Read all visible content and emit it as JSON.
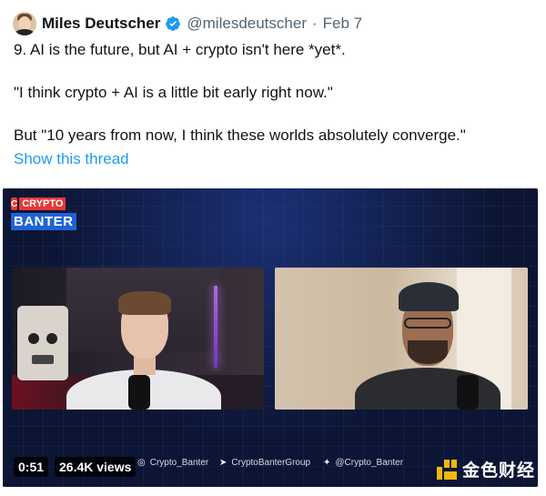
{
  "tweet": {
    "author_name": "Miles Deutscher",
    "author_handle": "@milesdeutscher",
    "separator": "·",
    "date": "Feb 7",
    "lines": [
      "9. AI is the future, but AI + crypto isn't here *yet*.",
      "\"I think crypto + AI is a little bit early right now.\"",
      "But \"10 years from now, I think these worlds absolutely converge.\""
    ],
    "show_thread": "Show this thread"
  },
  "video": {
    "logo_top": "CRYPTO",
    "logo_bottom": "BANTER",
    "logo_coin": "C",
    "duration": "0:51",
    "views": "26.4K views",
    "socials": [
      {
        "icon": "instagram-icon",
        "glyph": "◎",
        "handle": "Crypto_Banter"
      },
      {
        "icon": "telegram-icon",
        "glyph": "◀",
        "handle": "CryptoBanterGroup"
      },
      {
        "icon": "twitter-icon",
        "glyph": "🐦",
        "handle": "@Crypto_Banter"
      }
    ]
  },
  "watermark": {
    "text": "金色财经"
  },
  "colors": {
    "link": "#1d9bf0",
    "secondary_text": "#536471",
    "verified": "#1d9bf0",
    "watermark_gold": "#f0b90b"
  }
}
